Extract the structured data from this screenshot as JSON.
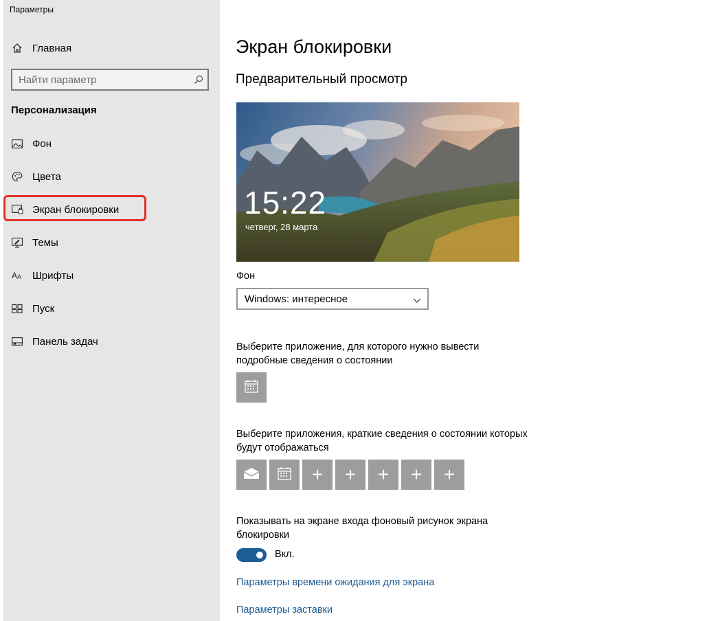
{
  "window": {
    "title": "Параметры"
  },
  "sidebar": {
    "home_label": "Главная",
    "search_placeholder": "Найти параметр",
    "section_title": "Персонализация",
    "items": [
      {
        "label": "Фон",
        "icon": "picture-icon"
      },
      {
        "label": "Цвета",
        "icon": "palette-icon"
      },
      {
        "label": "Экран блокировки",
        "icon": "lock-screen-icon",
        "selected": true
      },
      {
        "label": "Темы",
        "icon": "themes-icon"
      },
      {
        "label": "Шрифты",
        "icon": "fonts-icon"
      },
      {
        "label": "Пуск",
        "icon": "start-icon"
      },
      {
        "label": "Панель задач",
        "icon": "taskbar-icon"
      }
    ],
    "highlight_color": "#e0302a"
  },
  "main": {
    "title": "Экран блокировки",
    "preview_heading": "Предварительный просмотр",
    "preview": {
      "time": "15:22",
      "date": "четверг, 28 марта"
    },
    "background_label": "Фон",
    "background_value": "Windows: интересное",
    "detailed_app_label_1": "Выберите приложение, для которого нужно вывести",
    "detailed_app_label_2": "подробные сведения о состоянии",
    "quick_apps_label_1": "Выберите приложения, краткие сведения о состоянии которых",
    "quick_apps_label_2": "будут отображаться",
    "quick_apps": [
      "mail-icon",
      "calendar-icon",
      "+",
      "+",
      "+",
      "+",
      "+"
    ],
    "signin_label_1": "Показывать на экране входа фоновый рисунок экрана",
    "signin_label_2": "блокировки",
    "toggle_state": "Вкл.",
    "link_timeout": "Параметры времени ожидания для экрана",
    "link_screensaver": "Параметры заставки"
  },
  "colors": {
    "accent": "#1e5c95",
    "tile": "#9d9d9d",
    "sidebar_bg": "#e6e6e6"
  }
}
